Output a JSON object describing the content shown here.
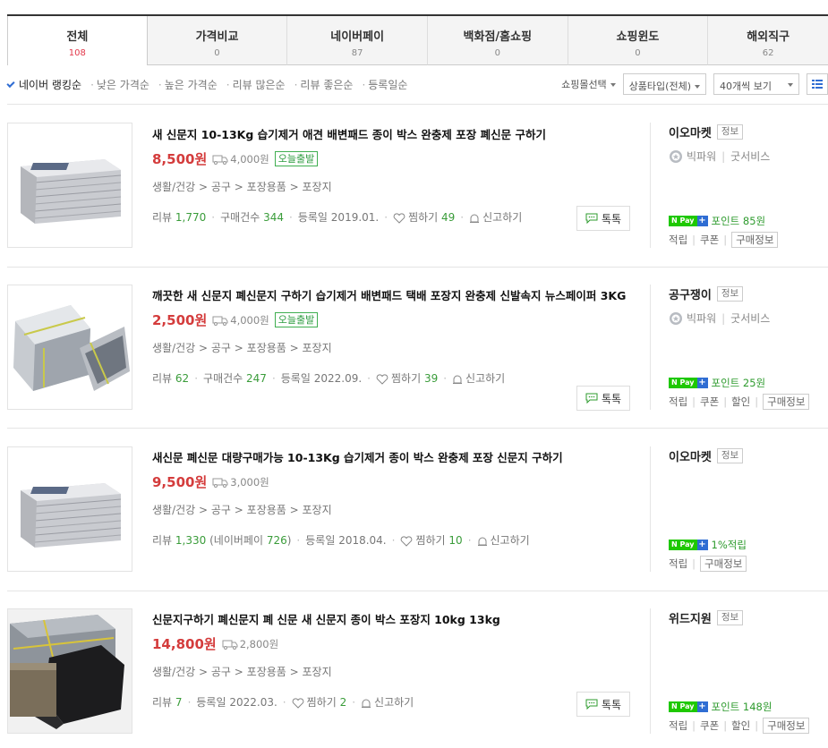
{
  "tabs": [
    {
      "label": "전체",
      "count": "108"
    },
    {
      "label": "가격비교",
      "count": "0"
    },
    {
      "label": "네이버페이",
      "count": "87"
    },
    {
      "label": "백화점/홈쇼핑",
      "count": "0"
    },
    {
      "label": "쇼핑윈도",
      "count": "0"
    },
    {
      "label": "해외직구",
      "count": "62"
    }
  ],
  "sorts": [
    "네이버 랭킹순",
    "낮은 가격순",
    "높은 가격순",
    "리뷰 많은순",
    "리뷰 좋은순",
    "등록일순"
  ],
  "filters": {
    "mall": "쇼핑몰선택",
    "product_type": "상품타입(전체)",
    "per_page": "40개씩 보기"
  },
  "labels": {
    "today_ship": "오늘출발",
    "review": "리뷰",
    "purchase": "구매건수",
    "npay_reviews": "네이버페이",
    "registered": "등록일",
    "wish": "찜하기",
    "report": "신고하기",
    "talk": "톡톡",
    "info": "정보",
    "grade_power": "빅파워",
    "grade_service": "굿서비스",
    "accrual": "적립",
    "coupon": "쿠폰",
    "discount": "할인",
    "purchase_info": "구매정보"
  },
  "products": [
    {
      "title": "새 신문지 10-13Kg 습기제거 애견 배변패드 종이 박스 완충제 포장 폐신문 구하기",
      "price": "8,500원",
      "shipping": "4,000원",
      "category": "생활/건강 > 공구 > 포장용품 > 포장지",
      "reviews": "1,770",
      "purchases": "344",
      "date": "2019.01.",
      "wishes": "49",
      "seller": "이오마켓",
      "npay": "포인트 85원"
    },
    {
      "title": "깨끗한 새 신문지 폐신문지 구하기 습기제거 배변패드 택배 포장지 완충제 신발속지 뉴스페이퍼 3KG",
      "price": "2,500원",
      "shipping": "4,000원",
      "category": "생활/건강 > 공구 > 포장용품 > 포장지",
      "reviews": "62",
      "purchases": "247",
      "date": "2022.09.",
      "wishes": "39",
      "seller": "공구쟁이",
      "npay": "포인트 25원"
    },
    {
      "title": "새신문 폐신문 대량구매가능 10-13Kg 습기제거 종이 박스 완충제 포장 신문지 구하기",
      "price": "9,500원",
      "shipping": "3,000원",
      "category": "생활/건강 > 공구 > 포장용품 > 포장지",
      "reviews": "1,330",
      "npay_count": "726",
      "date": "2018.04.",
      "wishes": "10",
      "seller": "이오마켓",
      "npay": "1%적립"
    },
    {
      "title": "신문지구하기 폐신문지 폐 신문 새 신문지 종이 박스 포장지 10kg 13kg",
      "price": "14,800원",
      "shipping": "2,800원",
      "category": "생활/건강 > 공구 > 포장용품 > 포장지",
      "reviews": "7",
      "date": "2022.03.",
      "wishes": "2",
      "seller": "위드지원",
      "npay": "포인트 148원"
    }
  ],
  "colors": {
    "price": "#d43c3c",
    "active_count": "#e2384a",
    "stat_number": "#3a9c3a",
    "npay_green": "#1ec800",
    "accent_blue": "#2f6dd3"
  }
}
